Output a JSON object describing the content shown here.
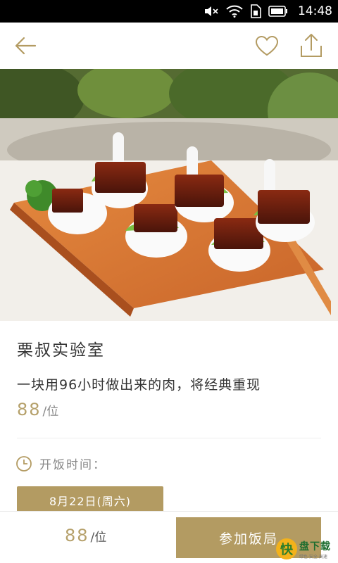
{
  "status_bar": {
    "time": "14:48",
    "icons": [
      "mute-icon",
      "wifi-icon",
      "sim-icon",
      "battery-icon"
    ]
  },
  "header": {
    "icons": [
      "back-arrow-icon",
      "heart-icon",
      "share-icon"
    ]
  },
  "event": {
    "title": "栗叔实验室",
    "description": "一块用96小时做出来的肉，将经典重现",
    "price": "88",
    "price_unit": "/位",
    "meal_time_label": "开饭时间：",
    "date": "8月22日(周六)"
  },
  "bottom_bar": {
    "price": "88",
    "price_unit": "/位",
    "join_label": "参加饭局"
  },
  "watermark": {
    "mark": "快",
    "name": "盘下载",
    "slogan": "绿色·安全·高速"
  },
  "colors": {
    "accent": "#b39b62",
    "price_text": "#b5a06a"
  }
}
